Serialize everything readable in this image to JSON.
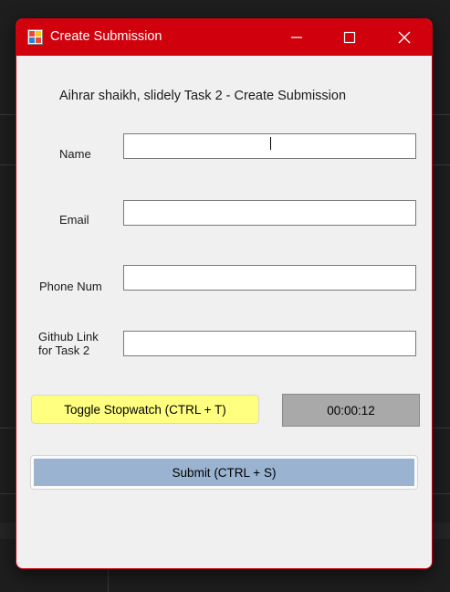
{
  "window": {
    "title": "Create Submission",
    "titlebar_color": "#d0000c"
  },
  "controls": {
    "minimize_icon": "minimize-icon",
    "maximize_icon": "maximize-icon",
    "close_icon": "close-icon"
  },
  "form": {
    "heading": "Aihrar shaikh, slidely Task 2 - Create Submission",
    "name_label": "Name",
    "name_value": "",
    "email_label": "Email",
    "email_value": "",
    "phone_label": "Phone Num",
    "phone_value": "",
    "github_label_line1": "Github Link",
    "github_label_line2": "for Task 2",
    "github_value": ""
  },
  "stopwatch": {
    "toggle_label": "Toggle Stopwatch (CTRL + T)",
    "time": "00:00:12",
    "toggle_color": "#ffff80"
  },
  "submit": {
    "label": "Submit (CTRL + S)",
    "color": "#9ab3d1"
  }
}
